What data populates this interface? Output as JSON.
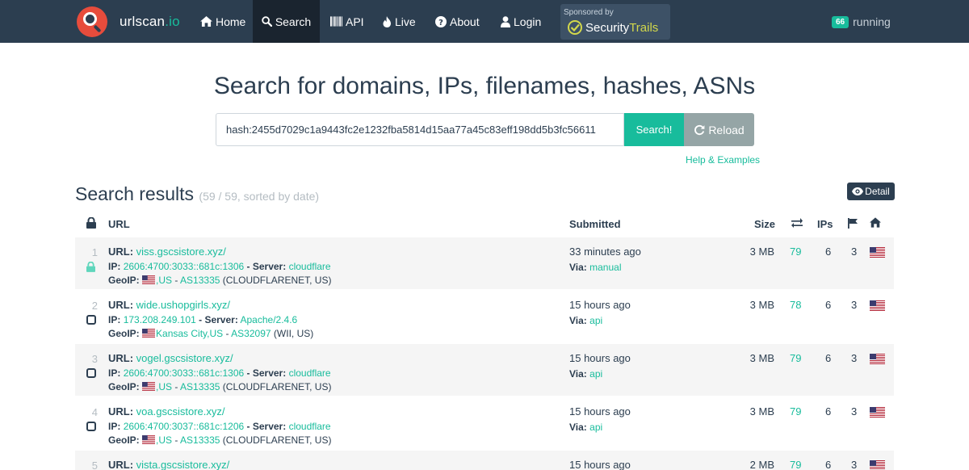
{
  "nav": {
    "brand": "urlscan",
    "brand_tld": ".io",
    "items": [
      {
        "label": "Home",
        "icon": "home-icon"
      },
      {
        "label": "Search",
        "icon": "search-icon",
        "active": true
      },
      {
        "label": "API",
        "icon": "barcode-icon"
      },
      {
        "label": "Live",
        "icon": "fire-icon"
      },
      {
        "label": "About",
        "icon": "question-circle-icon"
      },
      {
        "label": "Login",
        "icon": "user-icon"
      }
    ],
    "sponsor_label": "Sponsored by",
    "sponsor_name_a": "Security",
    "sponsor_name_b": "Trails",
    "running_count": "66",
    "running_label": "running"
  },
  "search": {
    "headline": "Search for domains, IPs, filenames, hashes, ASNs",
    "query": "hash:2455d7029c1a9443fc2e1232fba5814d15aa77a45c83eff198dd5b3fc56611",
    "search_button": "Search!",
    "reload_button": "Reload",
    "help_link": "Help & Examples"
  },
  "results": {
    "title": "Search results",
    "subtitle": "(59 / 59, sorted by date)",
    "detail_button": "Detail",
    "columns": {
      "url": "URL",
      "submitted": "Submitted",
      "size": "Size",
      "ips": "IPs"
    },
    "labels": {
      "url": "URL:",
      "ip": "IP:",
      "server": "Server:",
      "geoip": "GeoIP:",
      "via": "Via:",
      "dash": " - "
    },
    "rows": [
      {
        "n": "1",
        "url": "viss.gscsistore.xyz/",
        "ip": "2606:4700:3033::681c:1306",
        "server": "cloudflare",
        "geo_place": ",US",
        "asn": "AS13335",
        "asn_name": "(CLOUDFLARENET, US)",
        "submitted": "33 minutes ago",
        "via": "manual",
        "size": "3 MB",
        "requests": "79",
        "ips": "6",
        "countries": "3",
        "secure": true
      },
      {
        "n": "2",
        "url": "wide.ushopgirls.xyz/",
        "ip": "173.208.249.101",
        "server": "Apache/2.4.6",
        "geo_place": "Kansas City,US",
        "asn": "AS32097",
        "asn_name": "(WII, US)",
        "submitted": "15 hours ago",
        "via": "api",
        "size": "3 MB",
        "requests": "78",
        "ips": "6",
        "countries": "3",
        "secure": false
      },
      {
        "n": "3",
        "url": "vogel.gscsistore.xyz/",
        "ip": "2606:4700:3033::681c:1306",
        "server": "cloudflare",
        "geo_place": ",US",
        "asn": "AS13335",
        "asn_name": "(CLOUDFLARENET, US)",
        "submitted": "15 hours ago",
        "via": "api",
        "size": "3 MB",
        "requests": "79",
        "ips": "6",
        "countries": "3",
        "secure": false
      },
      {
        "n": "4",
        "url": "voa.gscsistore.xyz/",
        "ip": "2606:4700:3037::681c:1206",
        "server": "cloudflare",
        "geo_place": ",US",
        "asn": "AS13335",
        "asn_name": "(CLOUDFLARENET, US)",
        "submitted": "15 hours ago",
        "via": "api",
        "size": "3 MB",
        "requests": "79",
        "ips": "6",
        "countries": "3",
        "secure": false
      },
      {
        "n": "5",
        "url": "vista.gscsistore.xyz/",
        "submitted": "15 hours ago",
        "size": "2 MB",
        "requests": "79",
        "ips": "6",
        "countries": "3",
        "secure": false
      }
    ]
  },
  "colors": {
    "navbar": "#2c3e50",
    "accent": "#18bc9c",
    "logo": "#e74c3c",
    "reload": "#95a5a6"
  }
}
